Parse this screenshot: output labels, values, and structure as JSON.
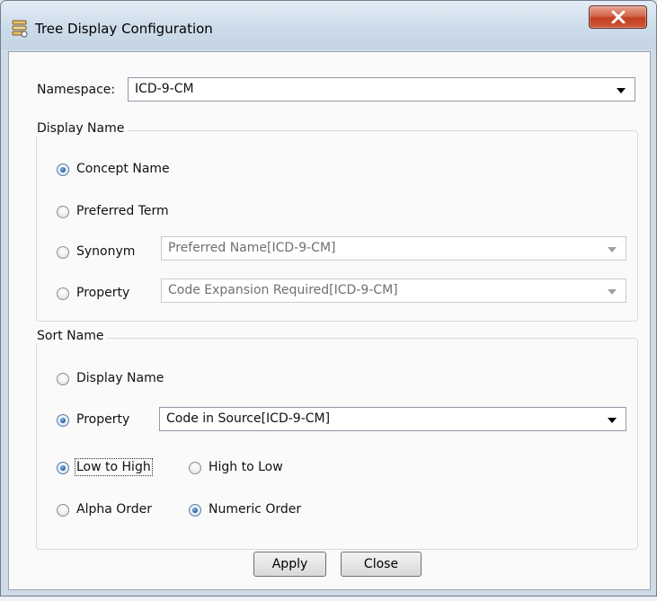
{
  "window": {
    "title": "Tree Display Configuration"
  },
  "namespace": {
    "label": "Namespace:",
    "value": "ICD-9-CM"
  },
  "display_name": {
    "title": "Display Name",
    "concept_name": "Concept Name",
    "preferred_term": "Preferred Term",
    "synonym": "Synonym",
    "synonym_value": "Preferred Name[ICD-9-CM]",
    "property": "Property",
    "property_value": "Code Expansion Required[ICD-9-CM]",
    "selected": "Concept Name"
  },
  "sort_name": {
    "title": "Sort Name",
    "display_name": "Display Name",
    "property": "Property",
    "property_value": "Code in Source[ICD-9-CM]",
    "selected": "Property",
    "low_to_high": "Low to High",
    "high_to_low": "High to Low",
    "direction_selected": "Low to High",
    "alpha_order": "Alpha Order",
    "numeric_order": "Numeric Order",
    "order_selected": "Numeric Order"
  },
  "buttons": {
    "apply": "Apply",
    "close": "Close"
  },
  "colors": {
    "close_button": "#c8452a",
    "radio_selected": "#2f66a8"
  }
}
